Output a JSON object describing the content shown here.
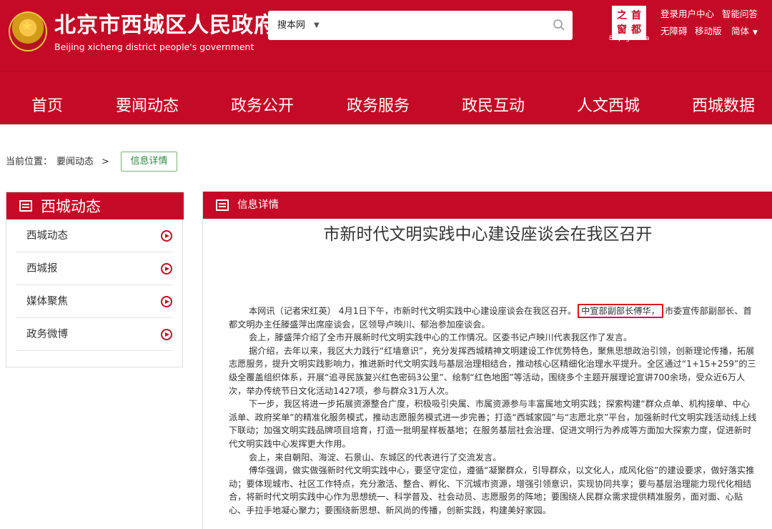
{
  "header": {
    "site_title": "北京市西城区人民政府",
    "site_subtitle": "Beijing xicheng district people's government",
    "search": {
      "scope": "搜本网",
      "placeholder": ""
    },
    "capital_logo": {
      "chars": [
        "之",
        "首",
        "窗",
        "都"
      ],
      "caption": "Beijing-China"
    },
    "links": [
      "登录用户中心",
      "智能问答",
      "无障碍",
      "移动版",
      "简体"
    ]
  },
  "nav": [
    "首页",
    "要闻动态",
    "政务公开",
    "政务服务",
    "政民互动",
    "人文西城",
    "西城数据"
  ],
  "breadcrumb": {
    "label": "当前位置：",
    "parent": "要闻动态",
    "sep": ">",
    "current": "信息详情"
  },
  "sidebar": {
    "title": "西城动态",
    "items": [
      "西城动态",
      "西城报",
      "媒体聚焦",
      "政务微博"
    ]
  },
  "main": {
    "section_title": "信息详情",
    "article_title": "市新时代文明实践中心建设座谈会在我区召开",
    "p1_pre": "本网讯（记者宋红英） 4月1日下午，市新时代文明实践中心建设座谈会在我区召开。",
    "p1_highlight": "中宣部副部长傅华，",
    "p1_post": "市委宣传部副部长、首都文明办主任滕盛萍出席座谈会，区领导卢映川、郁治参加座谈会。",
    "p2": "会上，滕盛萍介绍了全市开展新时代文明实践中心的工作情况。区委书记卢映川代表我区作了发言。",
    "p3": "据介绍，去年以来，我区大力践行“红墙意识”，充分发挥西城精神文明建设工作优势特色，聚焦思想政治引领，创新理论传播，拓展志愿服务，提升文明实践影响力，推进新时代文明实践与基层治理相结合，推动核心区精细化治理水平提升。全区通过“1+15+259”的三级全覆盖组织体系，开展“追寻民族复兴红色密码3公里”、绘制“红色地图”等活动，围绕多个主题开展理论宣讲700余场，受众近6万人次，举办传统节日文化活动1427项，参与群众31万人次。",
    "p4": "下一步，我区将进一步拓展资源整合广度，积极吸引央属、市属资源参与丰富属地文明实践；探索构建“群众点单、机构接单、中心派单、政府奖单”的精准化服务模式，推动志愿服务模式进一步完善；打造“西城家园”与“志愿北京”平台，加强新时代文明实践活动线上线下联动；加强文明实践品牌项目培育，打造一批明星样板基地；在服务基层社会治理、促进文明行为养成等方面加大探索力度，促进新时代文明实践中心发挥更大作用。",
    "p5": "会上，来自朝阳、海淀、石景山、东城区的代表进行了交流发言。",
    "p6": "傅华强调，做实做强新时代文明实践中心，要坚守定位，遵循“凝聚群众，引导群众，以文化人，成风化俗”的建设要求，做好落实推动；要体现城市、社区工作特点，充分激活、整合、孵化、下沉城市资源，增强引领意识，实现协同共享；要与基层治理能力现代化相结合，将新时代文明实践中心作为思想统一、科学普及、社会动员、志愿服务的阵地；要围绕人民群众需求提供精准服务，面对面、心贴心、手拉手地凝心聚力；要围绕新思想、新风尚的传播，创新实践，构建美好家园。"
  },
  "colors": {
    "brand_red": "#c40a26",
    "highlight_red": "#d9141c",
    "tag_green": "#2b8a43"
  }
}
